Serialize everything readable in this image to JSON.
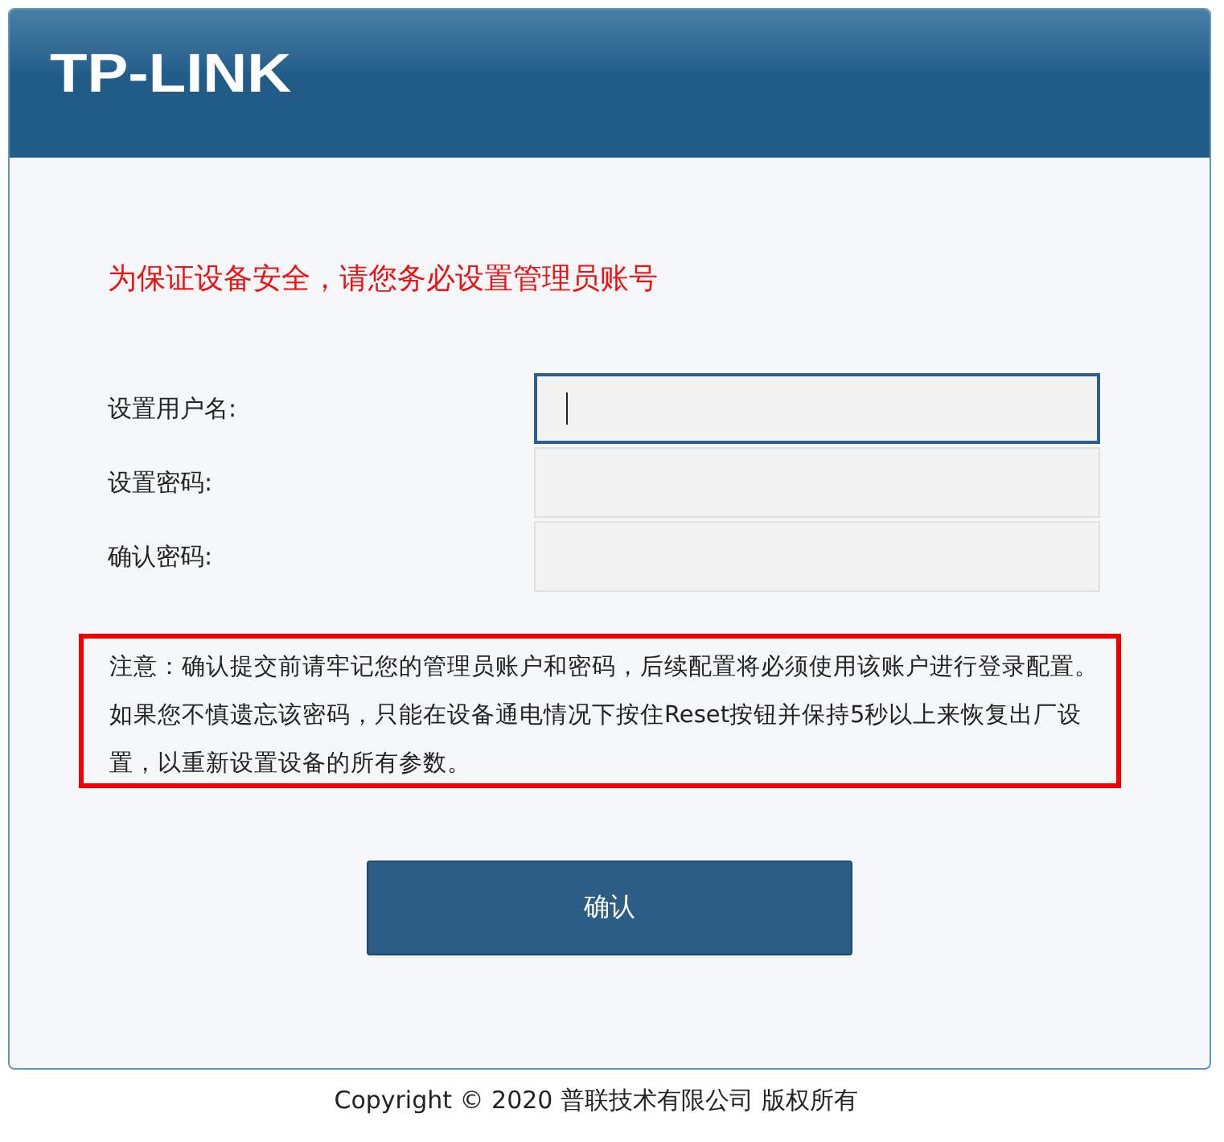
{
  "header": {
    "logo": "TP-LINK"
  },
  "warning": "为保证设备安全，请您务必设置管理员账号",
  "fields": [
    {
      "label": "设置用户名:",
      "focused": true
    },
    {
      "label": "设置密码:",
      "focused": false
    },
    {
      "label": "确认密码:",
      "focused": false
    }
  ],
  "notice": "注意：确认提交前请牢记您的管理员账户和密码，后续配置将必须使用该账户进行登录配置。如果您不慎遗忘该密码，只能在设备通电情况下按住Reset按钮并保持5秒以上来恢复出厂设置，以重新设置设备的所有参数。",
  "button": "确认",
  "footer": "Copyright © 2020 普联技术有限公司 版权所有"
}
